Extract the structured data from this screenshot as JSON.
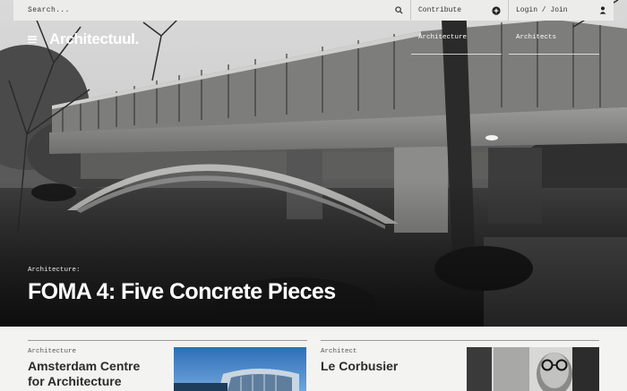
{
  "topbar": {
    "search_placeholder": "Search...",
    "contribute_label": "Contribute",
    "login_label": "Login / Join"
  },
  "brand": {
    "logo": "Architectuul."
  },
  "nav": {
    "items": [
      {
        "label": "Architecture"
      },
      {
        "label": "Architects"
      }
    ]
  },
  "hero": {
    "kicker": "Architecture:",
    "title": "FOMA 4: Five Concrete Pieces"
  },
  "cards": [
    {
      "kicker": "Architecture",
      "title_line1": "Amsterdam Centre",
      "title_line2": "for Architecture"
    },
    {
      "kicker": "Architect",
      "title_line1": "Le Corbusier"
    }
  ]
}
